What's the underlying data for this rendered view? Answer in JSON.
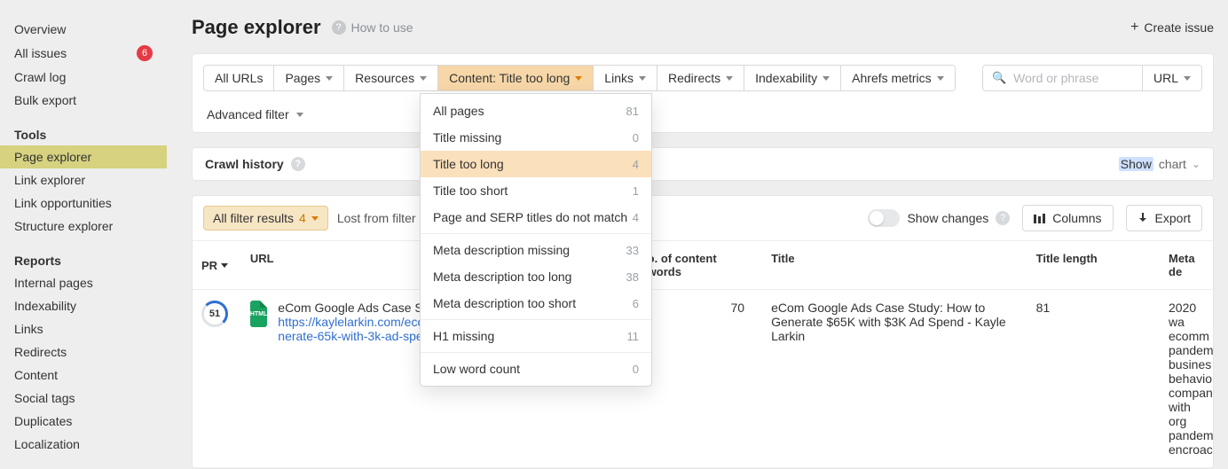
{
  "sidebar": {
    "top": [
      {
        "label": "Overview"
      },
      {
        "label": "All issues",
        "badge": "6"
      },
      {
        "label": "Crawl log"
      },
      {
        "label": "Bulk export"
      }
    ],
    "tools_header": "Tools",
    "tools": [
      {
        "label": "Page explorer",
        "active": true
      },
      {
        "label": "Link explorer"
      },
      {
        "label": "Link opportunities"
      },
      {
        "label": "Structure explorer"
      }
    ],
    "reports_header": "Reports",
    "reports": [
      {
        "label": "Internal pages"
      },
      {
        "label": "Indexability"
      },
      {
        "label": "Links"
      },
      {
        "label": "Redirects"
      },
      {
        "label": "Content"
      },
      {
        "label": "Social tags"
      },
      {
        "label": "Duplicates"
      },
      {
        "label": "Localization"
      }
    ]
  },
  "header": {
    "title": "Page explorer",
    "how_to_use": "How to use",
    "create_issue": "Create issue"
  },
  "filters": {
    "all_urls": "All URLs",
    "pages": "Pages",
    "resources": "Resources",
    "content_label": "Content: Title too long",
    "links": "Links",
    "redirects": "Redirects",
    "indexability": "Indexability",
    "ahrefs": "Ahrefs metrics",
    "search_placeholder": "Word or phrase",
    "url_scope": "URL",
    "advanced": "Advanced filter"
  },
  "content_dropdown": [
    {
      "label": "All pages",
      "count": "81"
    },
    {
      "label": "Title missing",
      "count": "0"
    },
    {
      "label": "Title too long",
      "count": "4",
      "highlight": true
    },
    {
      "label": "Title too short",
      "count": "1"
    },
    {
      "label": "Page and SERP titles do not match",
      "count": "4"
    },
    {
      "sep": true
    },
    {
      "label": "Meta description missing",
      "count": "33"
    },
    {
      "label": "Meta description too long",
      "count": "38"
    },
    {
      "label": "Meta description too short",
      "count": "6"
    },
    {
      "sep": true
    },
    {
      "label": "H1 missing",
      "count": "11"
    },
    {
      "sep": true
    },
    {
      "label": "Low word count",
      "count": "0"
    }
  ],
  "crawl_history": {
    "label": "Crawl history",
    "show": "Show",
    "chart": "chart"
  },
  "table_toolbar": {
    "all_filter": "All filter results",
    "all_filter_count": "4",
    "lost": "Lost from filter re",
    "show_changes": "Show changes",
    "columns": "Columns",
    "export": "Export"
  },
  "table": {
    "headers": {
      "pr": "PR",
      "url": "URL",
      "words": "o. of content words",
      "title": "Title",
      "tlen": "Title length",
      "meta": "Meta de"
    },
    "rows": [
      {
        "pr": "51",
        "url_title": "eCom Google Ads Case S",
        "url_link": "https://kaylelarkin.com/ecom-google-ads-case-study-how-to-generate-65k-with-3k-ad-spend/",
        "words": "70",
        "title": "eCom Google Ads Case Study: How to Generate $65K with $3K Ad Spend - Kayle Larkin",
        "tlen": "81",
        "meta": "2020 wa\necomm\npandem\nbusines\nbehavio\ncompan\nwith org\npandem\nencroac"
      }
    ]
  }
}
